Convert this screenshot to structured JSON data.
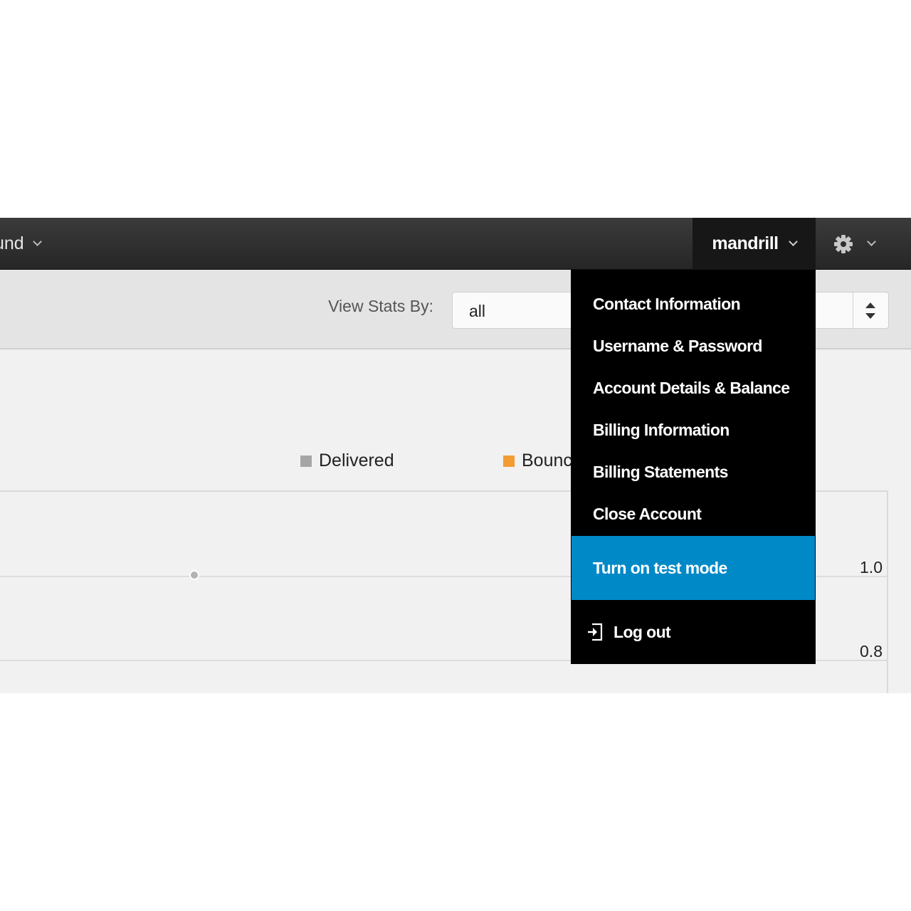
{
  "topbar": {
    "nav_partial_label": "und",
    "user_label": "mandrill",
    "settings_icon": "gear-icon"
  },
  "toolbar": {
    "view_stats_label": "View Stats By:",
    "view_stats_value": "all"
  },
  "chart": {
    "legend": [
      {
        "label": "Delivered",
        "color": "#a6a6a6"
      },
      {
        "label": "Bounc",
        "color": "#f39c31"
      }
    ],
    "y_ticks": [
      "1.0",
      "0.8"
    ]
  },
  "chart_data": {
    "type": "line",
    "series": [
      {
        "name": "Delivered",
        "values": [
          1.0
        ]
      },
      {
        "name": "Bounc",
        "values": []
      }
    ],
    "y_ticks": [
      1.0,
      0.8
    ],
    "legend_position": "top"
  },
  "dropdown": {
    "items": [
      "Contact Information",
      "Username & Password",
      "Account Details & Balance",
      "Billing Information",
      "Billing Statements",
      "Close Account"
    ],
    "active_item": "Turn on test mode",
    "logout_label": "Log out",
    "logout_icon": "logout-icon",
    "active_color": "#0089c7"
  }
}
